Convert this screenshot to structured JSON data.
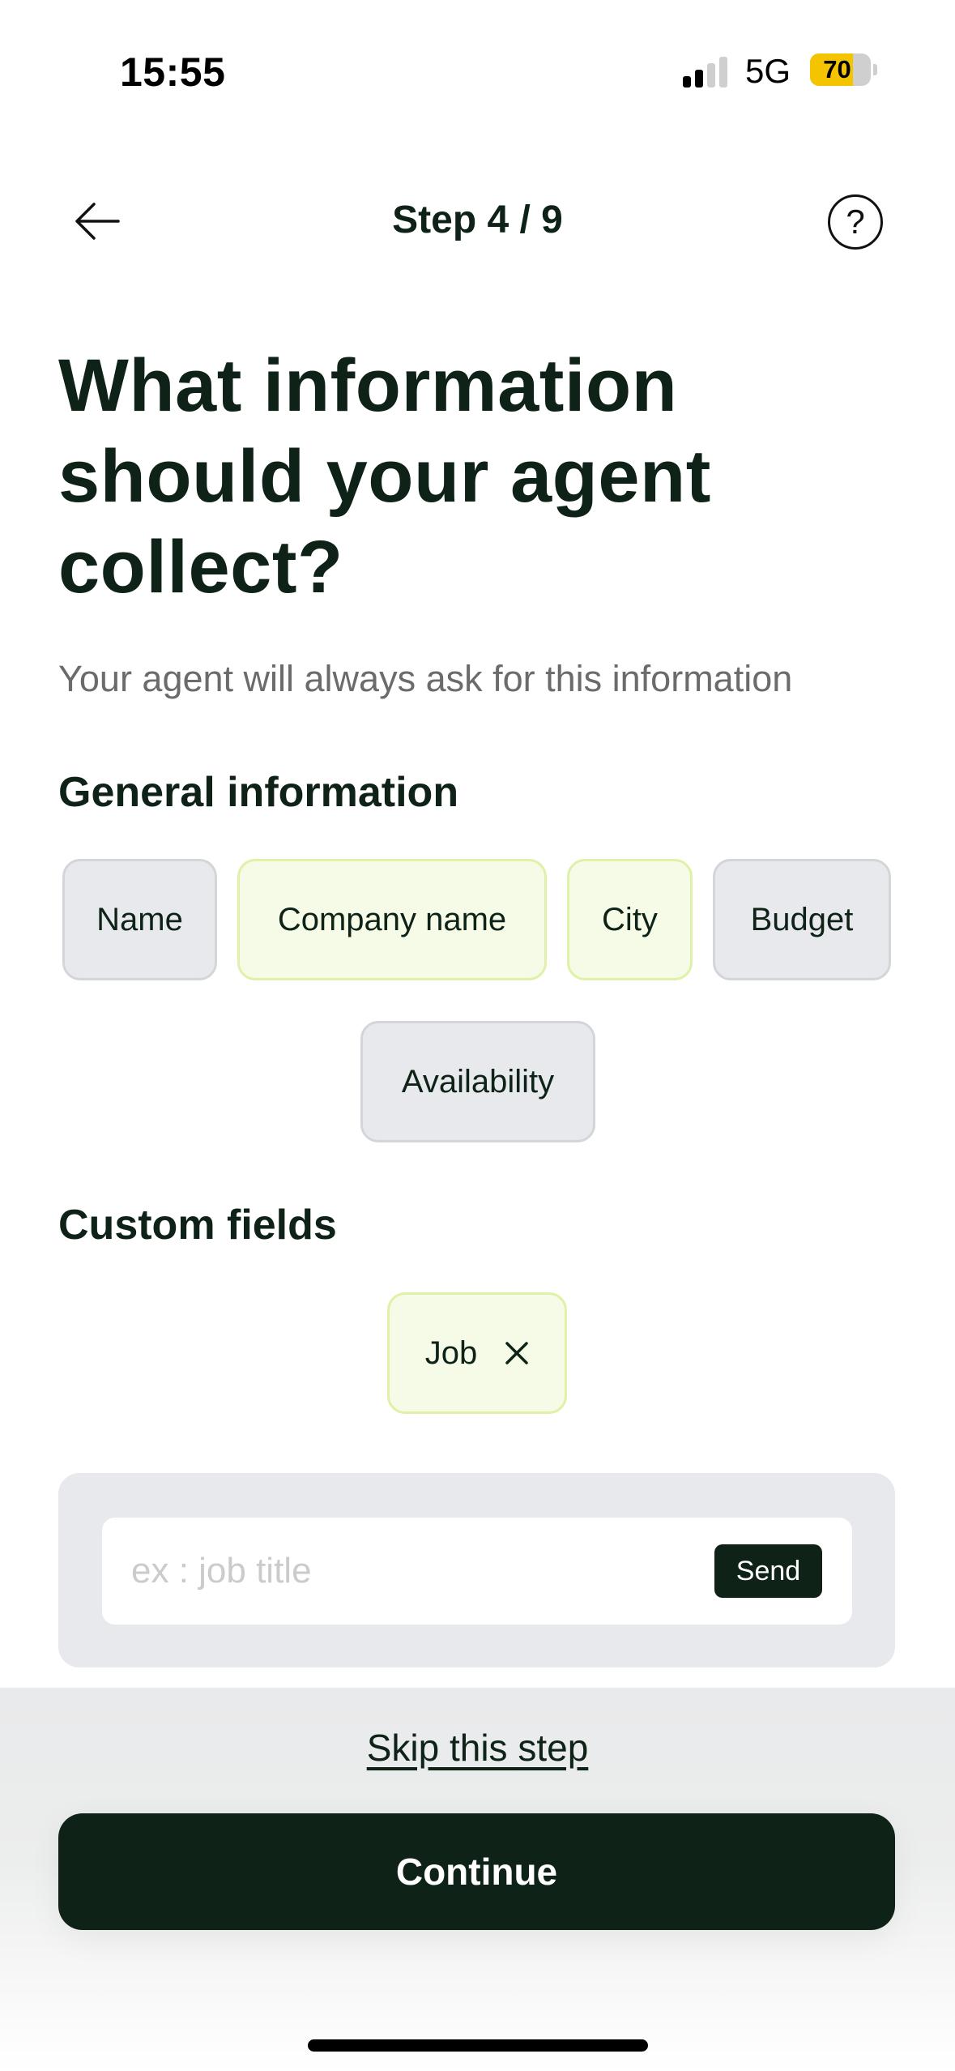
{
  "status_bar": {
    "time": "15:55",
    "network": "5G",
    "signal_bars_total": 4,
    "signal_bars_active": 2,
    "battery_percent": 70,
    "battery_label": "70",
    "battery_color": "#f5c400"
  },
  "nav": {
    "back_icon": "arrow-left-icon",
    "step_label": "Step 4 / 9",
    "help_icon": "question-circle-icon",
    "help_glyph": "?"
  },
  "header": {
    "title": "What information should your agent collect?",
    "subtitle": "Your agent will always ask for this information"
  },
  "general_information": {
    "heading": "General information",
    "chips": [
      {
        "label": "Name",
        "selected": false
      },
      {
        "label": "Company name",
        "selected": true
      },
      {
        "label": "City",
        "selected": true
      },
      {
        "label": "Budget",
        "selected": false
      },
      {
        "label": "Availability",
        "selected": false
      }
    ]
  },
  "custom_fields": {
    "heading": "Custom fields",
    "chips": [
      {
        "label": "Job",
        "removable": true,
        "remove_icon": "close-icon"
      }
    ],
    "input": {
      "value": "",
      "placeholder": "ex : job title",
      "send_label": "Send"
    }
  },
  "footer": {
    "skip_label": "Skip this step",
    "continue_label": "Continue"
  },
  "colors": {
    "primary_dark": "#0e2217",
    "chip_selected_bg": "#f5fbe6",
    "chip_selected_border": "#dff1a8",
    "chip_default_bg": "#e8e9ed",
    "chip_default_border": "#d4d5da",
    "subtitle_text": "#6b6b6b"
  }
}
